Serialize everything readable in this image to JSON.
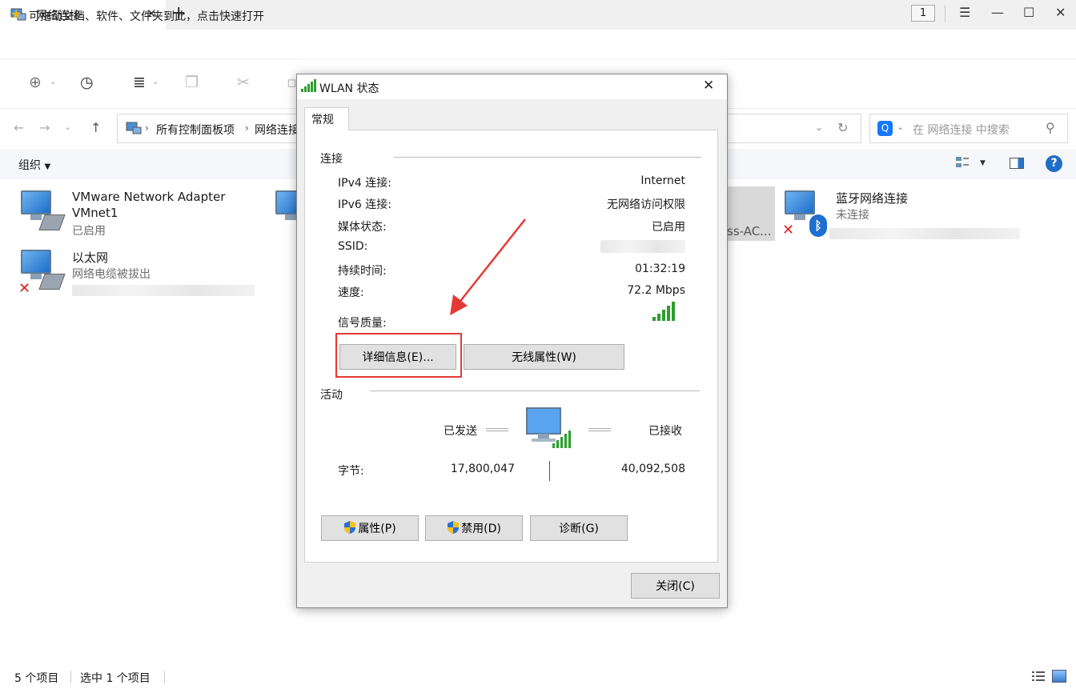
{
  "browser": {
    "tab_title": "网络连接",
    "tab_close": "✕",
    "new_tab": "+",
    "window_count": "1"
  },
  "favorites": {
    "hint": "可拖动文档、软件、文件夹到此，点击快速打开"
  },
  "address": {
    "path_root": "所有控制面板项",
    "path_current": "网络连接",
    "search_placeholder": "在 网络连接 中搜索"
  },
  "command_bar": {
    "organize": "组织",
    "help": "?"
  },
  "files": [
    {
      "name": "VMware Network Adapter",
      "name2": "VMnet1",
      "status": "已启用"
    },
    {
      "name": "以太网",
      "status": "网络电缆被拔出"
    },
    {
      "name": "蓝牙网络连接",
      "status": "未连接"
    },
    {
      "partial_label": "ss-AC..."
    }
  ],
  "statusbar": {
    "count": "5 个项目",
    "selected": "选中 1 个项目"
  },
  "dialog": {
    "title": "WLAN 状态",
    "tab": "常规",
    "connection_group": "连接",
    "rows": [
      {
        "label": "IPv4 连接:",
        "value": "Internet"
      },
      {
        "label": "IPv6 连接:",
        "value": "无网络访问权限"
      },
      {
        "label": "媒体状态:",
        "value": "已启用"
      },
      {
        "label": "SSID:",
        "value": ""
      },
      {
        "label": "持续时间:",
        "value": "01:32:19"
      },
      {
        "label": "速度:",
        "value": "72.2 Mbps"
      }
    ],
    "signal_label": "信号质量:",
    "details_button": "详细信息(E)...",
    "wireless_button": "无线属性(W)",
    "activity_group": "活动",
    "sent_label": "已发送",
    "received_label": "已接收",
    "bytes_label": "字节:",
    "bytes_sent": "17,800,047",
    "bytes_received": "40,092,508",
    "properties_button": "属性(P)",
    "disable_button": "禁用(D)",
    "diagnose_button": "诊断(G)",
    "close_button": "关闭(C)"
  },
  "colors": {
    "highlight": "#e53935",
    "accent": "#1e6fc8",
    "signal": "#2e9e2e"
  }
}
